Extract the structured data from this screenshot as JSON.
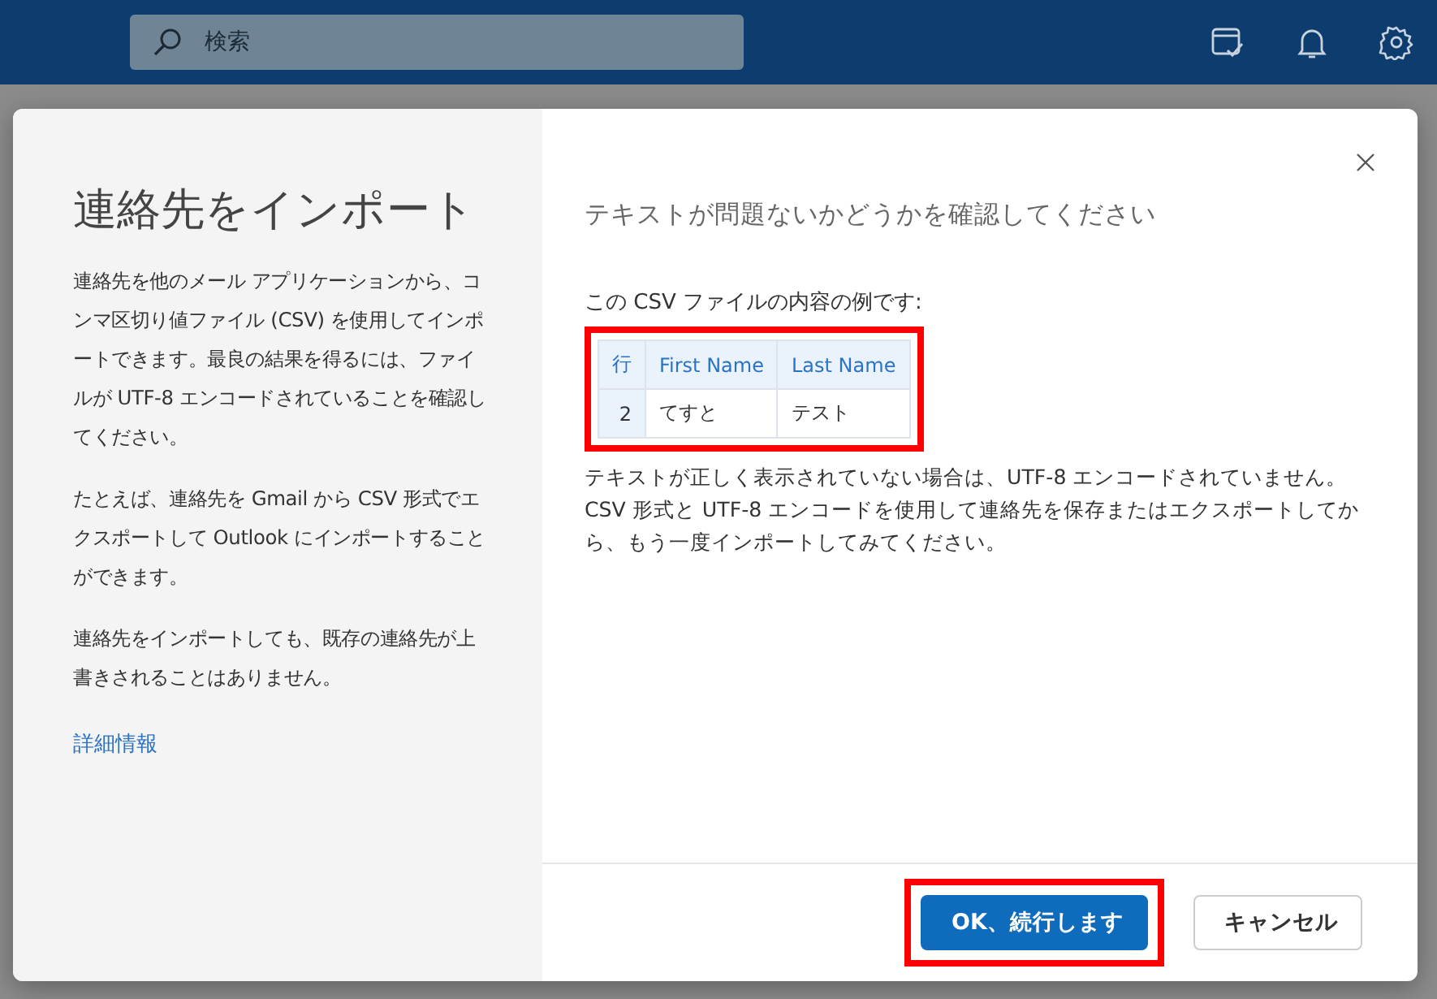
{
  "top_bar": {
    "search": {
      "placeholder": "検索"
    }
  },
  "dialog": {
    "title": "連絡先をインポート",
    "paragraphs": [
      "連絡先を他のメール アプリケーションから、コンマ区切り値ファイル (CSV) を使用してインポートできます。最良の結果を得るには、ファイルが UTF-8 エンコードされていることを確認してください。",
      "たとえば、連絡先を Gmail から CSV 形式でエクスポートして Outlook にインポートすることができます。",
      "連絡先をインポートしても、既存の連絡先が上書きされることはありません。"
    ],
    "link": "詳細情報",
    "heading": "テキストが問題ないかどうかを確認してください",
    "intro": "この CSV ファイルの内容の例です:",
    "preview_table": {
      "highlighted": true,
      "columns": [
        "行",
        "First Name",
        "Last Name"
      ],
      "rows": [
        [
          "2",
          "てすと",
          "テスト"
        ]
      ]
    },
    "note": "テキストが正しく表示されていない場合は、UTF-8 エンコードされていません。CSV 形式と UTF-8 エンコードを使用して連絡先を保存またはエクスポートしてから、もう一度インポートしてみてください。",
    "buttons": [
      {
        "label": "OK、続行します",
        "kind": "primary",
        "highlighted": true
      },
      {
        "label": "キャンセル",
        "kind": "secondary",
        "highlighted": false
      }
    ]
  }
}
